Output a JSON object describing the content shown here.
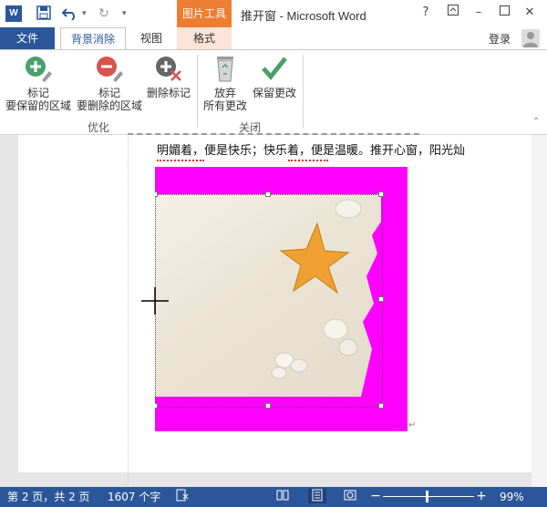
{
  "titlebar": {
    "app_icon_letter": "W",
    "context_group_label": "图片工具",
    "window_title": "推开窗 - Microsoft Word",
    "help_label": "?",
    "minimize_label": "–",
    "close_label": "✕"
  },
  "tabs": {
    "file": "文件",
    "background_removal": "背景消除",
    "view": "视图",
    "format": "格式",
    "signin": "登录"
  },
  "ribbon": {
    "mark_keep": {
      "line1": "标记",
      "line2": "要保留的区域"
    },
    "mark_remove": {
      "line1": "标记",
      "line2": "要删除的区域"
    },
    "delete_mark": "删除标记",
    "discard": {
      "line1": "放弃",
      "line2": "所有更改"
    },
    "keep_changes": "保留更改",
    "group_refine": "优化",
    "group_close": "关闭"
  },
  "document": {
    "line1": "明媚着，便是快乐；快乐着，便是温暖。推开心窗，阳光灿"
  },
  "status": {
    "page_info": "第 2 页，共 2 页",
    "word_count": "1607 个字",
    "zoom": "99%",
    "zoom_minus": "−",
    "zoom_plus": "+"
  },
  "colors": {
    "brand_blue": "#2b579a",
    "context_orange": "#ed7d31",
    "removal_magenta": "#ff00ff",
    "keep_green": "#4a9f6a",
    "remove_red": "#d9534f"
  }
}
